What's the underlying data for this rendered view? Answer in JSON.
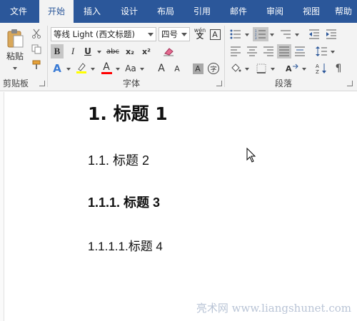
{
  "tabs": [
    {
      "label": "文件",
      "active": false
    },
    {
      "label": "开始",
      "active": true
    },
    {
      "label": "插入",
      "active": false
    },
    {
      "label": "设计",
      "active": false
    },
    {
      "label": "布局",
      "active": false
    },
    {
      "label": "引用",
      "active": false
    },
    {
      "label": "邮件",
      "active": false
    },
    {
      "label": "审阅",
      "active": false
    },
    {
      "label": "视图",
      "active": false
    },
    {
      "label": "帮助",
      "active": false
    }
  ],
  "clipboard": {
    "paste_label": "粘贴",
    "group_label": "剪贴板"
  },
  "font": {
    "name_value": "等线 Light (西文标题)",
    "size_value": "四号",
    "group_label": "字体",
    "bold": "B",
    "italic": "I",
    "underline": "U",
    "strike": "abc",
    "subscript": "x₂",
    "superscript": "x²",
    "grow": "A",
    "shrink": "A",
    "case": "Aa",
    "phonetic": "wén",
    "border_char": "A",
    "shade_char": "A",
    "enclose_char": "字",
    "effects": "A",
    "font_color": "A"
  },
  "paragraph": {
    "group_label": "段落"
  },
  "colors": {
    "accent": "#2b579a",
    "ribbon_bg": "#f3f3f3",
    "highlight": "#ffff00",
    "font_color": "#ff0000"
  },
  "document": {
    "heading1": "1. 标题 1",
    "heading2": "1.1. 标题 2",
    "heading3": "1.1.1. 标题 3",
    "heading4": "1.1.1.1.标题 4"
  },
  "watermark": "亮术网 www.liangshunet.com"
}
